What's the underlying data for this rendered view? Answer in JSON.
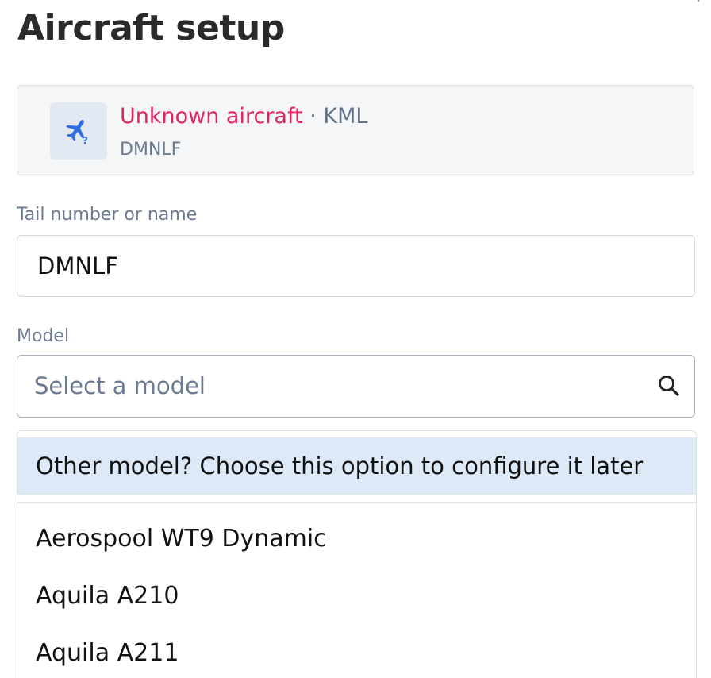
{
  "page": {
    "title": "Aircraft setup",
    "corner_mark": "·"
  },
  "aircraft_card": {
    "icon": "airplane-question-icon",
    "status": "Unknown aircraft",
    "separator": "·",
    "source_type": "KML",
    "identifier": "DMNLF"
  },
  "tail_field": {
    "label": "Tail number or name",
    "value": "DMNLF"
  },
  "model_field": {
    "label": "Model",
    "placeholder": "Select a model",
    "icon": "search-icon"
  },
  "dropdown": {
    "highlighted_option": "Other model? Choose this option to configure it later",
    "options": [
      "Aerospool WT9 Dynamic",
      "Aquila A210",
      "Aquila A211"
    ]
  },
  "colors": {
    "status_red": "#e0245e",
    "icon_blue": "#2f6fe4",
    "highlight_bg": "#dee9f8"
  }
}
